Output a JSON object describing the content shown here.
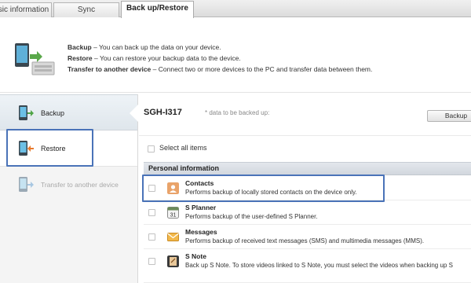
{
  "tabs": [
    {
      "label": "sic information"
    },
    {
      "label": "Sync"
    },
    {
      "label": "Back up/Restore"
    }
  ],
  "header": {
    "lines": [
      {
        "term": "Backup",
        "text": " – You can back up the data on your device."
      },
      {
        "term": "Restore",
        "text": " – You can restore your backup data to the device."
      },
      {
        "term": "Transfer to another device",
        "text": " – Connect two or more devices to the PC and transfer data between them."
      }
    ]
  },
  "modes": [
    {
      "label": "Backup",
      "icon": "phone-backup-icon"
    },
    {
      "label": "Restore",
      "icon": "phone-restore-icon"
    },
    {
      "label": "Transfer to another device",
      "icon": "phone-transfer-icon"
    }
  ],
  "main": {
    "device_name": "SGH-I317",
    "device_sub": "* data to be backed up:",
    "backup_button": "Backup",
    "select_all": "Select all items",
    "section": "Personal information",
    "items": [
      {
        "title": "Contacts",
        "desc": "Performs backup of locally stored contacts on the device only.",
        "icon": "contacts-icon"
      },
      {
        "title": "S Planner",
        "desc": "Performs backup of the user-defined S Planner.",
        "icon": "calendar-icon"
      },
      {
        "title": "Messages",
        "desc": "Performs backup of received text messages (SMS) and multimedia messages (MMS).",
        "icon": "messages-icon"
      },
      {
        "title": "S Note",
        "desc": "Back up S Note. To store videos linked to S Note, you must select the videos when backing up S",
        "icon": "snote-icon"
      }
    ]
  },
  "colors": {
    "highlight": "#4a73b8",
    "section_bg": "#d9dee4"
  }
}
